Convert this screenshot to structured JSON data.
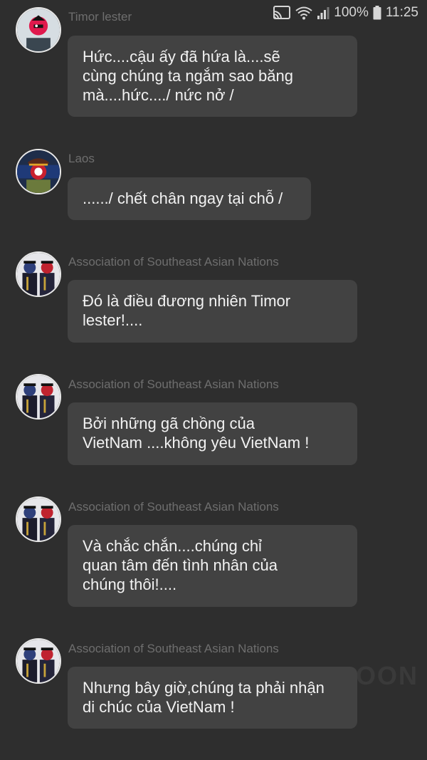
{
  "status_bar": {
    "battery": "100%",
    "time": "11:25"
  },
  "watermark": "OON",
  "messages": [
    {
      "sender": "Timor lester",
      "avatar": "avatar-timor-lester",
      "text": "Hức....cậu ấy đã hứa là....sẽ\ncùng chúng ta ngắm sao băng\nmà....hức..../ nức nở /"
    },
    {
      "sender": "Laos",
      "avatar": "avatar-laos",
      "text": "....../ chết chân ngay tại chỗ /"
    },
    {
      "sender": "Association of Southeast Asian Nations",
      "avatar": "avatar-asean",
      "text": "Đó là điều đương nhiên Timor\nlester!...."
    },
    {
      "sender": "Association of Southeast Asian Nations",
      "avatar": "avatar-asean",
      "text": "Bởi những gã chồng của\nVietNam ....không yêu VietNam !"
    },
    {
      "sender": "Association of Southeast Asian Nations",
      "avatar": "avatar-asean",
      "text": "Và chắc chắn....chúng chỉ\nquan tâm đến tình nhân của\nchúng thôi!...."
    },
    {
      "sender": "Association of Southeast Asian Nations",
      "avatar": "avatar-asean",
      "text": "Nhưng bây giờ,chúng ta phải nhận\ndi chúc của VietNam !"
    }
  ]
}
